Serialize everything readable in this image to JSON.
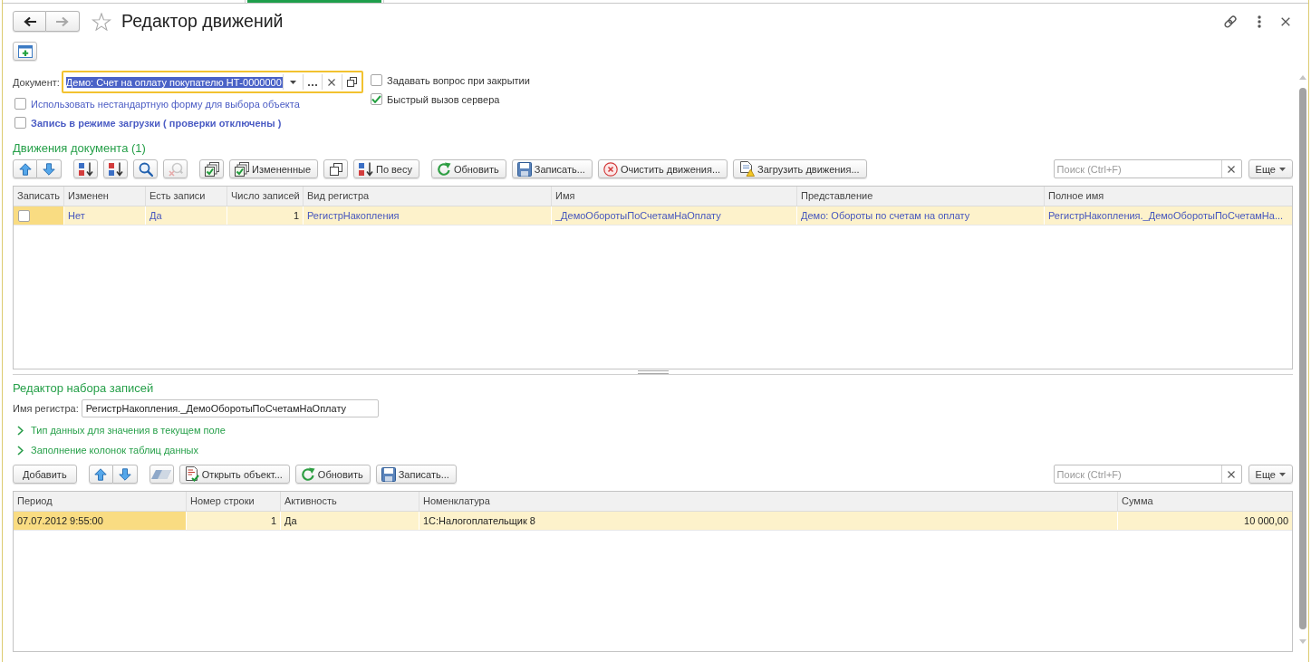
{
  "window": {
    "title": "Редактор движений",
    "favorite": false,
    "navigation": [
      {
        "kind": "back",
        "disabled": false
      },
      {
        "kind": "forward",
        "disabled": true
      }
    ]
  },
  "form": {
    "document": {
      "label": "Документ:",
      "value": "Демо: Счет на оплату покупателю НТ-0000000",
      "focused": true
    },
    "options_left": [
      {
        "label": "Использовать нестандартную форму для выбора объекта",
        "checked": false
      },
      {
        "label": "Запись в режиме загрузки ( проверки отключены )",
        "checked": false
      }
    ],
    "options_right": [
      {
        "label": "Задавать вопрос при закрытии",
        "checked": false
      },
      {
        "label": "Быстрый вызов сервера",
        "checked": true
      }
    ]
  },
  "movements": {
    "title": "Движения документа (1)",
    "toolbar": {
      "groups": [
        {
          "joined": true,
          "buttons": [
            {
              "kind": "move-up",
              "disabled": false
            },
            {
              "kind": "move-down",
              "disabled": false
            }
          ]
        },
        {
          "joined": false,
          "buttons": [
            {
              "kind": "sort-asc",
              "disabled": false
            },
            {
              "kind": "sort-desc",
              "disabled": false
            },
            {
              "kind": "find",
              "disabled": false
            },
            {
              "kind": "cancel-find",
              "disabled": true
            }
          ]
        },
        {
          "joined": false,
          "buttons": [
            {
              "kind": "check-all",
              "disabled": false
            },
            {
              "kind": "changed",
              "label": "Измененные",
              "disabled": false
            },
            {
              "kind": "copy",
              "disabled": false
            },
            {
              "kind": "sort-weight",
              "label": "По весу",
              "disabled": false
            }
          ]
        },
        {
          "joined": false,
          "buttons": [
            {
              "kind": "refresh",
              "label": "Обновить",
              "disabled": false
            },
            {
              "kind": "save",
              "label": "Записать...",
              "disabled": false
            },
            {
              "kind": "clear",
              "label": "Очистить движения...",
              "disabled": false
            },
            {
              "kind": "load",
              "label": "Загрузить движения...",
              "disabled": false
            }
          ]
        }
      ],
      "search": {
        "placeholder": "Поиск (Ctrl+F)"
      },
      "more": "Еще"
    },
    "table": {
      "columns": [
        "Записать",
        "Изменен",
        "Есть записи",
        "Число записей",
        "Вид регистра",
        "Имя",
        "Представление",
        "Полное имя"
      ],
      "rows": [
        {
          "selected": true,
          "cells": [
            {
              "kind": "checkbox",
              "checked": false,
              "current": true
            },
            {
              "kind": "ref",
              "text": "Нет",
              "current": false
            },
            {
              "kind": "ref",
              "text": "Да",
              "current": false
            },
            {
              "kind": "number",
              "text": "1",
              "current": false
            },
            {
              "kind": "ref",
              "text": "РегистрНакопления",
              "current": false
            },
            {
              "kind": "ref",
              "text": "_ДемоОборотыПоСчетамНаОплату",
              "current": false
            },
            {
              "kind": "ref",
              "text": "Демо: Обороты по счетам на оплату",
              "current": false
            },
            {
              "kind": "ref",
              "text": "РегистрНакопления._ДемоОборотыПоСчетамНа...",
              "current": false
            }
          ]
        }
      ]
    }
  },
  "record_set_editor": {
    "title": "Редактор набора записей",
    "register_name": {
      "label": "Имя регистра:",
      "value": "РегистрНакопления._ДемоОборотыПоСчетамНаОплату"
    },
    "groups": [
      {
        "title": "Тип данных для значения в текущем поле",
        "expanded": false
      },
      {
        "title": "Заполнение колонок таблиц данных",
        "expanded": false
      }
    ],
    "toolbar": {
      "groups": [
        {
          "joined": false,
          "buttons": [
            {
              "kind": "add",
              "label": "Добавить",
              "disabled": false
            }
          ]
        },
        {
          "joined": true,
          "buttons": [
            {
              "kind": "move-up",
              "disabled": false
            },
            {
              "kind": "move-down",
              "disabled": false
            }
          ]
        },
        {
          "joined": false,
          "buttons": [
            {
              "kind": "clear-cell",
              "disabled": false
            },
            {
              "kind": "open-object",
              "label": "Открыть объект...",
              "disabled": false
            },
            {
              "kind": "refresh",
              "label": "Обновить",
              "disabled": false
            },
            {
              "kind": "save",
              "label": "Записать...",
              "disabled": false
            }
          ]
        }
      ],
      "search": {
        "placeholder": "Поиск (Ctrl+F)"
      },
      "more": "Еще"
    },
    "table": {
      "columns": [
        "Период",
        "Номер строки",
        "Активность",
        "Номенклатура",
        "Сумма"
      ],
      "rows": [
        {
          "selected": true,
          "cells": [
            {
              "kind": "text",
              "text": "07.07.2012 9:55:00",
              "current": true
            },
            {
              "kind": "number",
              "text": "1",
              "current": false
            },
            {
              "kind": "text",
              "text": "Да",
              "current": false
            },
            {
              "kind": "text",
              "text": "1С:Налогоплательщик 8",
              "current": false
            },
            {
              "kind": "number",
              "text": "10 000,00",
              "current": false
            }
          ]
        }
      ]
    }
  }
}
